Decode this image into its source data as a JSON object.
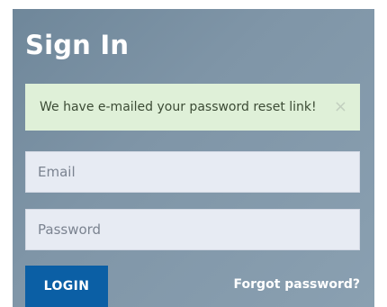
{
  "signin": {
    "title": "Sign In",
    "alert": {
      "message": "We have e-mailed your password reset link!",
      "close_symbol": "×"
    },
    "email": {
      "placeholder": "Email",
      "value": ""
    },
    "password": {
      "placeholder": "Password",
      "value": ""
    },
    "login_label": "LOGIN",
    "forgot_label": "Forgot password?"
  }
}
